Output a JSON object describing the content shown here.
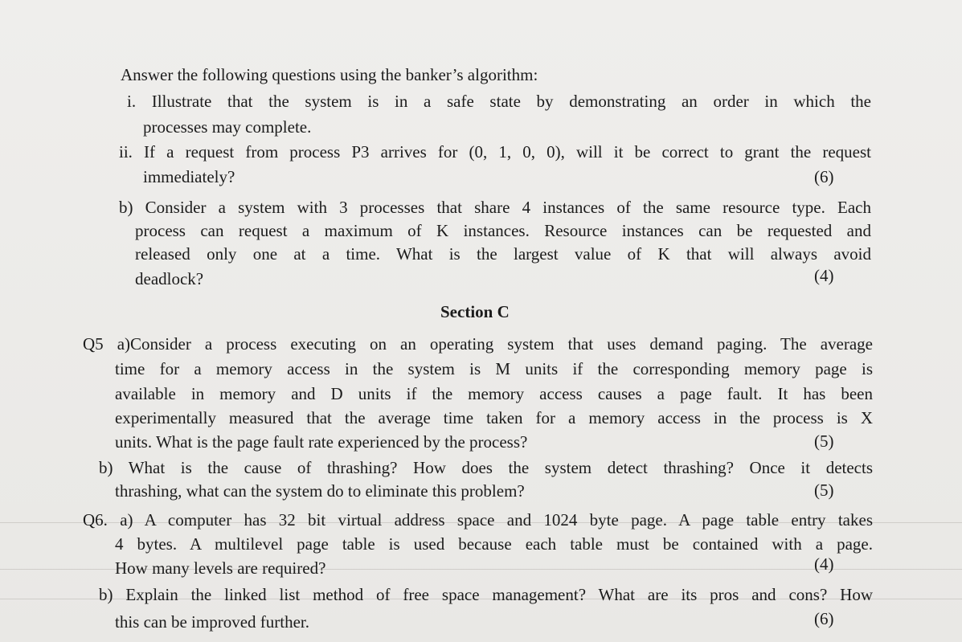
{
  "intro": "Answer the following questions using the banker’s algorithm:",
  "q_i_line1": "i. Illustrate that the system is in a safe state by demonstrating an order in which the",
  "q_i_line2": "processes may complete.",
  "q_ii_line1": "ii. If a request from process P3 arrives for (0, 1, 0, 0), will it be correct to grant the request",
  "q_ii_line2": "immediately?",
  "q_ii_marks": "(6)",
  "q_b_line1": "b) Consider a system with 3 processes that share 4 instances of the same resource type. Each",
  "q_b_line2": "process can request a maximum of K instances. Resource instances can be requested and",
  "q_b_line3": "released only one at a time. What is the largest value of K that will always avoid",
  "q_b_line4": "deadlock?",
  "q_b_marks": "(4)",
  "section_title": "Section C",
  "q5a_line1": "Q5 a)Consider a process executing on an operating system that uses demand paging. The average",
  "q5a_line2": "time for a memory access in the system is M units if the corresponding memory page is",
  "q5a_line3": "available in memory and D units if the memory access causes a page fault. It has been",
  "q5a_line4": "experimentally measured that the average time taken for a memory access in the process is X",
  "q5a_line5": "units. What is the page fault rate experienced by the process?",
  "q5a_marks": "(5)",
  "q5b_line1": "b) What is the cause of thrashing? How does the system detect thrashing? Once it detects",
  "q5b_line2": "thrashing, what can the system do to eliminate this problem?",
  "q5b_marks": "(5)",
  "q6a_line1": "Q6. a) A computer has 32 bit virtual address space and 1024 byte page. A page table entry takes",
  "q6a_line2": "4 bytes. A multilevel page table is used because each table must be contained with a page.",
  "q6a_line3": "How many levels are required?",
  "q6a_marks": "(4)",
  "q6b_line1": "b) Explain the linked list method of free space management? What are its pros and cons? How",
  "q6b_line2": "this can be improved further.",
  "q6b_marks": "(6)"
}
